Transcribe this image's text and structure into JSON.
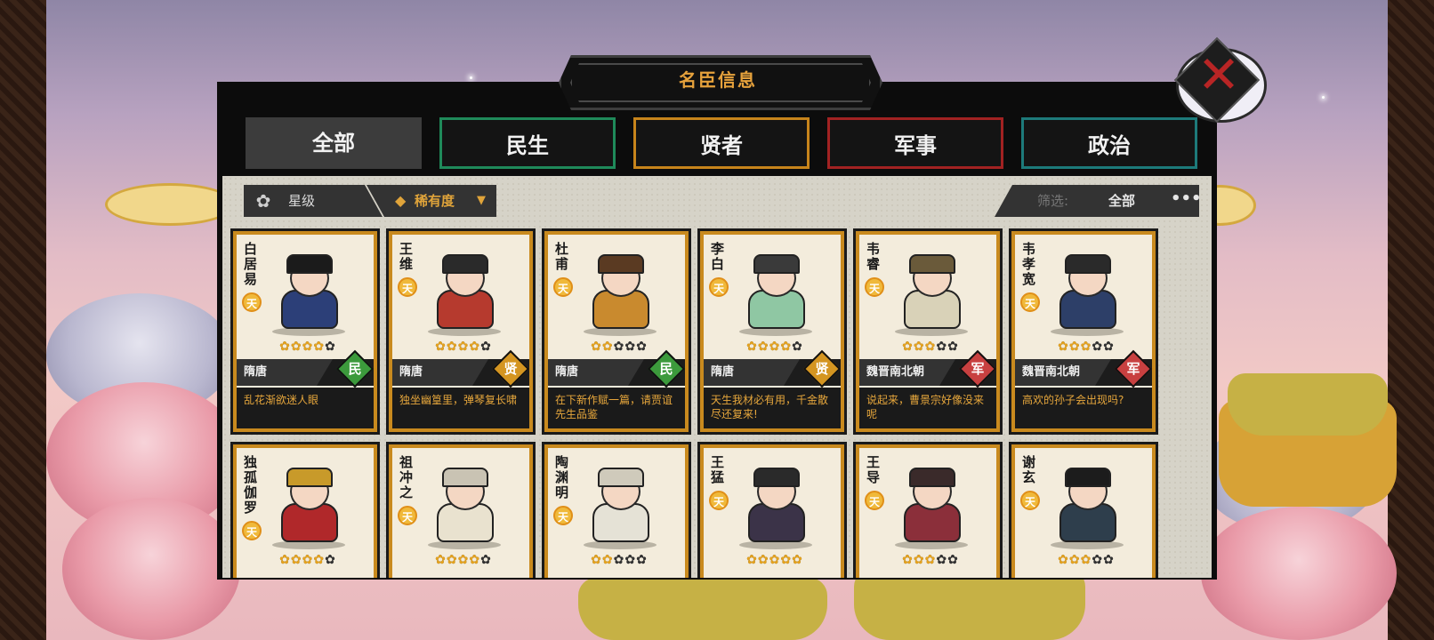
{
  "title": "名臣信息",
  "close": {
    "icon": "close-x-icon",
    "glyph": "✕"
  },
  "tabs": [
    {
      "label": "全部",
      "style": "active"
    },
    {
      "label": "民生",
      "style": "green"
    },
    {
      "label": "贤者",
      "style": "orange"
    },
    {
      "label": "军事",
      "style": "red"
    },
    {
      "label": "政治",
      "style": "teal"
    }
  ],
  "toolbar": {
    "sort_star": {
      "icon": "flower-icon",
      "glyph": "✿",
      "label": "星级"
    },
    "sort_rarity": {
      "icon": "diamond-icon",
      "glyph": "◆",
      "label": "稀有度",
      "arrow": "▼"
    },
    "filter": {
      "label": "筛选:",
      "value": "全部",
      "more": "•••"
    }
  },
  "grade_label": "天",
  "cards": [
    {
      "name": "白居易",
      "era": "隋唐",
      "tag": "民",
      "tag_color": "green",
      "stars": 4,
      "quote": "乱花渐欲迷人眼",
      "robe": "#2c3f78",
      "hat": "#1b1b1b"
    },
    {
      "name": "王维",
      "era": "隋唐",
      "tag": "贤",
      "tag_color": "gold",
      "stars": 4,
      "quote": "独坐幽篁里，弹琴复长啸",
      "robe": "#b63a2e",
      "hat": "#2a2a2a"
    },
    {
      "name": "杜甫",
      "era": "隋唐",
      "tag": "民",
      "tag_color": "green",
      "stars": 2,
      "quote": "在下新作赋一篇，请贾谊先生品鉴",
      "robe": "#c98a2e",
      "hat": "#5a3a22"
    },
    {
      "name": "李白",
      "era": "隋唐",
      "tag": "贤",
      "tag_color": "gold",
      "stars": 4,
      "quote": "天生我材必有用，千金散尽还复来!",
      "robe": "#8fc7a3",
      "hat": "#3a3a3a"
    },
    {
      "name": "韦睿",
      "era": "魏晋南北朝",
      "tag": "军",
      "tag_color": "red",
      "stars": 3,
      "quote": "说起来，曹景宗好像没来呢",
      "robe": "#d9d2b8",
      "hat": "#6a5a3a"
    },
    {
      "name": "韦孝宽",
      "era": "魏晋南北朝",
      "tag": "军",
      "tag_color": "red",
      "stars": 3,
      "quote": "高欢的孙子会出现吗?",
      "robe": "#2d3f68",
      "hat": "#2a2a2a"
    },
    {
      "name": "独孤伽罗",
      "era": "",
      "tag": "",
      "tag_color": "",
      "stars": 4,
      "quote": "",
      "robe": "#b0282a",
      "hat": "#c89a2a"
    },
    {
      "name": "祖冲之",
      "era": "",
      "tag": "",
      "tag_color": "",
      "stars": 4,
      "quote": "",
      "robe": "#e9e2cf",
      "hat": "#c9c3b3"
    },
    {
      "name": "陶渊明",
      "era": "",
      "tag": "",
      "tag_color": "",
      "stars": 2,
      "quote": "",
      "robe": "#e5e2d6",
      "hat": "#cfcabb"
    },
    {
      "name": "王猛",
      "era": "",
      "tag": "",
      "tag_color": "",
      "stars": 5,
      "quote": "",
      "robe": "#3b3348",
      "hat": "#2a2a2a"
    },
    {
      "name": "王导",
      "era": "",
      "tag": "",
      "tag_color": "",
      "stars": 3,
      "quote": "",
      "robe": "#8b2f3a",
      "hat": "#3a2a2a"
    },
    {
      "name": "谢玄",
      "era": "",
      "tag": "",
      "tag_color": "",
      "stars": 3,
      "quote": "",
      "robe": "#2e3e4c",
      "hat": "#1c1c1c"
    }
  ],
  "star_full": "✿",
  "star_empty": "✿"
}
